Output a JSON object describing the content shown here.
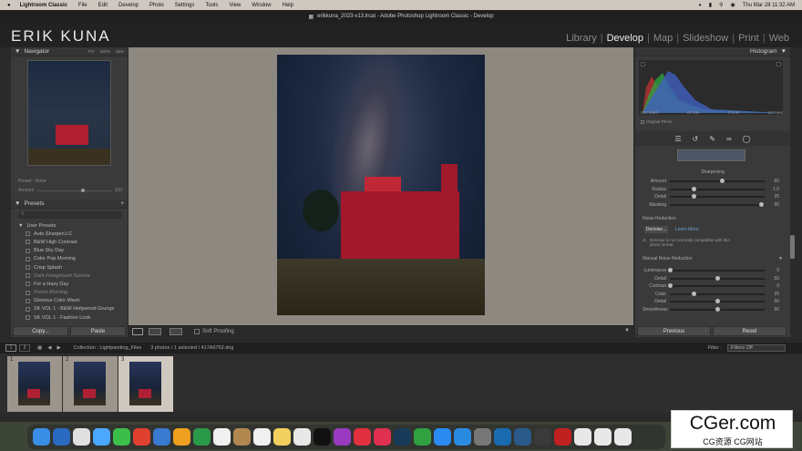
{
  "menubar": {
    "apple": "",
    "app_name": "Lightroom Classic",
    "items": [
      "File",
      "Edit",
      "Develop",
      "Photo",
      "Settings",
      "Tools",
      "View",
      "Window",
      "Help"
    ],
    "clock": "Thu Mar 28  11:32 AM"
  },
  "window": {
    "title": "erikkuna_2023-v13.lrcat - Adobe Photoshop Lightroom Classic - Develop"
  },
  "identity_plate": "ERIK KUNA",
  "modules": [
    "Library",
    "Develop",
    "Map",
    "Slideshow",
    "Print",
    "Web"
  ],
  "active_module": "Develop",
  "left": {
    "navigator_title": "Navigator",
    "navigator_zoom": [
      "FIT",
      "100%",
      "25%"
    ],
    "preset_label": "Preset : None",
    "amount_label": "Amount",
    "amount_value": "100",
    "presets_title": "Presets",
    "user_presets": "User Presets",
    "presets": [
      "Auto.Sharpen.LC",
      "B&W High Contrast",
      "Blue Sky Day",
      "Color Pop Morning",
      "Crisp Splash",
      "Dark Foreground Sunrise",
      "For a Hazy Day",
      "Forest Morning",
      "Glorious Color Wash",
      "SK VOL 1 - B&W Hollywood Grunge",
      "SK VOL 1 - Fashion Look"
    ],
    "copy_label": "Copy...",
    "paste_label": "Paste"
  },
  "center_toolbar": {
    "soft_proofing": "Soft Proofing"
  },
  "right": {
    "histogram_title": "Histogram",
    "exif": [
      "ISO 6400",
      "22 mm",
      "f / 2.8",
      "13.0 sec"
    ],
    "original_photo": "Original Photo",
    "sharpening_title": "Sharpening",
    "sharpening": [
      {
        "label": "Amount",
        "value": "60",
        "pos": 0.55
      },
      {
        "label": "Radius",
        "value": "1.0",
        "pos": 0.25
      },
      {
        "label": "Detail",
        "value": "25",
        "pos": 0.25
      },
      {
        "label": "Masking",
        "value": "96",
        "pos": 0.96
      }
    ],
    "noise_title": "Noise Reduction",
    "denoise_label": "Denoise...",
    "learn_more": "Learn More",
    "denoise_warning": "Denoise is not currently compatible with this photo format.",
    "manual_nr": "Manual Noise Reduction",
    "noise": [
      {
        "label": "Luminance",
        "value": "0",
        "pos": 0.0
      },
      {
        "label": "Detail",
        "value": "50",
        "pos": 0.5
      },
      {
        "label": "Contrast",
        "value": "0",
        "pos": 0.0
      },
      {
        "label": "Color",
        "value": "25",
        "pos": 0.25
      },
      {
        "label": "Detail",
        "value": "50",
        "pos": 0.5
      },
      {
        "label": "Smoothness",
        "value": "50",
        "pos": 0.5
      }
    ],
    "previous_label": "Previous",
    "reset_label": "Reset"
  },
  "filmstrip": {
    "collection": "Collection : Lightpainting_Files",
    "count": "3 photos / 1 selected / 417A6762.dng",
    "filter_label": "Filter :",
    "filter_value": "Filters Off",
    "pages": [
      "1",
      "2"
    ],
    "thumbs": [
      "1",
      "2",
      "3"
    ]
  },
  "watermark": {
    "big": "CGer.com",
    "small": "CG资源 CG网站"
  }
}
